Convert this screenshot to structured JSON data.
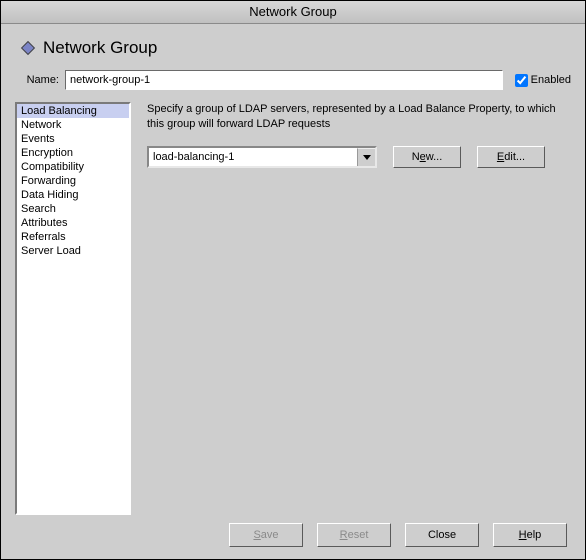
{
  "window": {
    "title": "Network Group"
  },
  "header": {
    "title": "Network Group"
  },
  "nameRow": {
    "label": "Name:",
    "value": "network-group-1",
    "enabledLabel": "Enabled",
    "enabledChecked": true
  },
  "categories": {
    "items": [
      {
        "label": "Load Balancing",
        "selected": true
      },
      {
        "label": "Network"
      },
      {
        "label": "Events"
      },
      {
        "label": "Encryption"
      },
      {
        "label": "Compatibility"
      },
      {
        "label": "Forwarding"
      },
      {
        "label": "Data Hiding"
      },
      {
        "label": "Search"
      },
      {
        "label": "Attributes"
      },
      {
        "label": "Referrals"
      },
      {
        "label": "Server Load"
      }
    ]
  },
  "detail": {
    "description": "Specify a group of LDAP servers, represented by a Load Balance Property, to which this group will forward LDAP requests",
    "combo": {
      "value": "load-balancing-1"
    },
    "buttons": {
      "new_before": "N",
      "new_ul": "e",
      "new_after": "w...",
      "edit_ul": "E",
      "edit_after": "dit..."
    }
  },
  "footer": {
    "save_ul": "S",
    "save_after": "ave",
    "reset_ul": "R",
    "reset_after": "eset",
    "close": "Close",
    "help_ul": "H",
    "help_after": "elp"
  }
}
